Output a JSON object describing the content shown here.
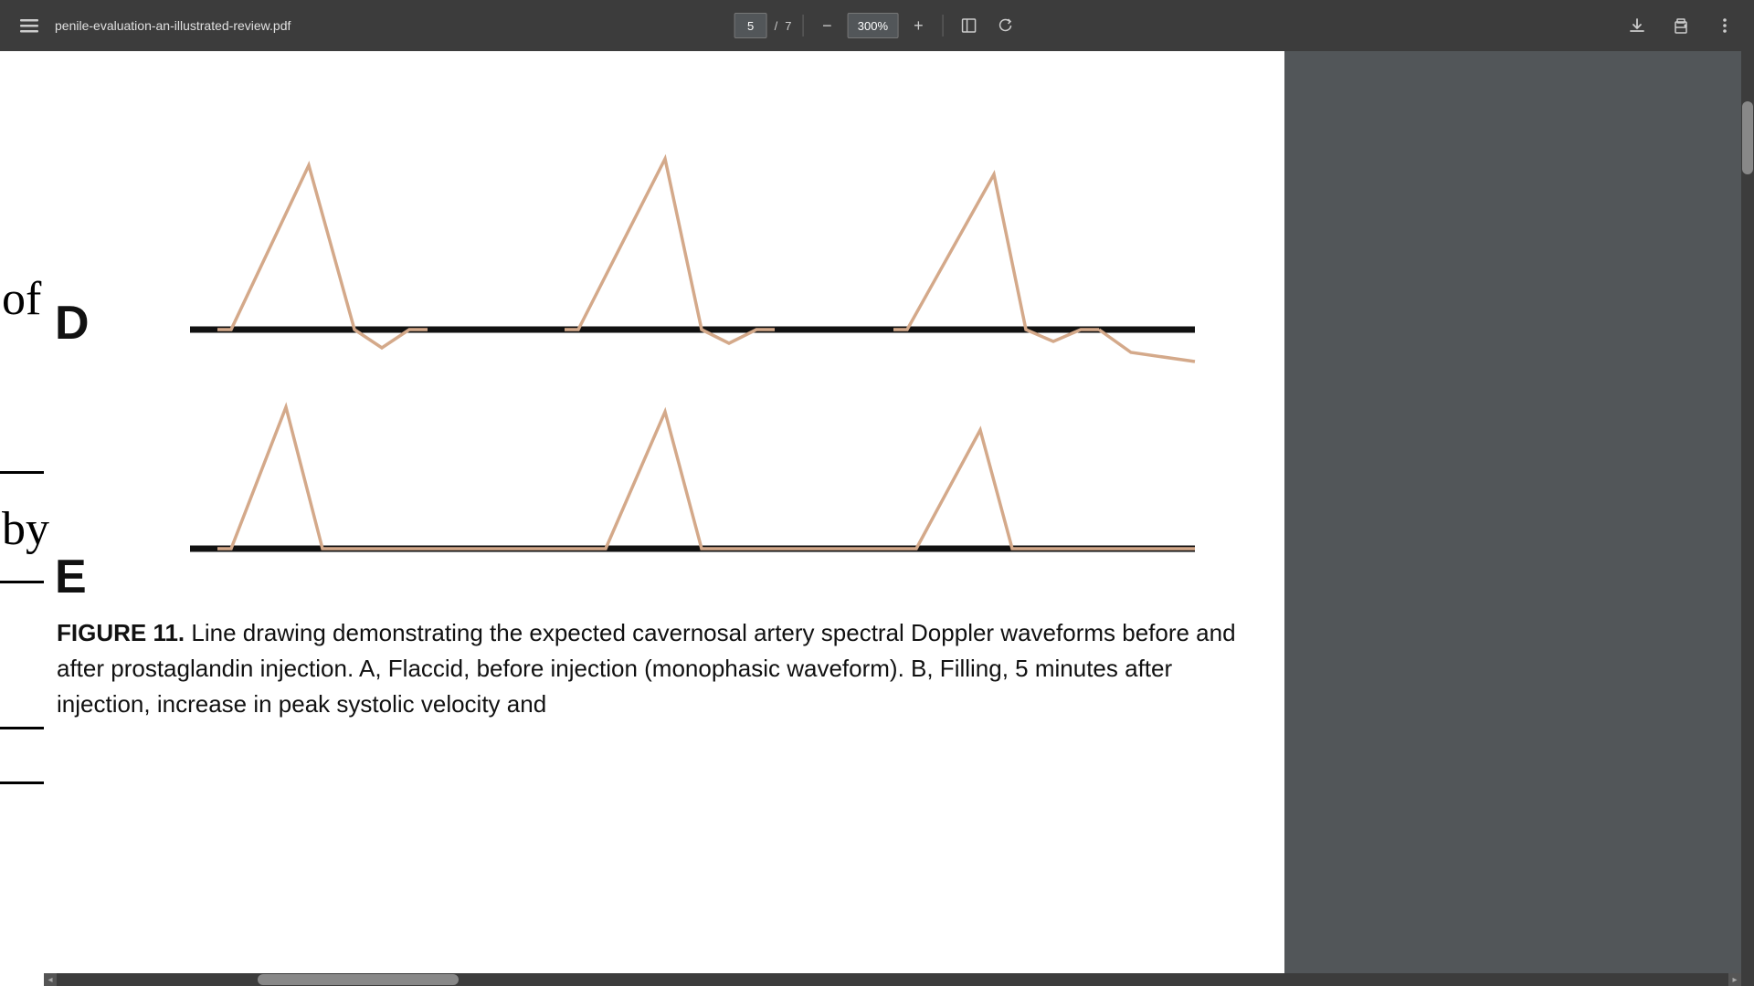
{
  "toolbar": {
    "menu_label": "☰",
    "title": "penile-evaluation-an-illustrated-review.pdf",
    "page_current": "5",
    "page_separator": "/",
    "page_total": "7",
    "zoom_minus": "−",
    "zoom_level": "300%",
    "zoom_plus": "+",
    "download_icon": "⬇",
    "print_icon": "🖨",
    "more_icon": "⋮",
    "rotate_icon": "↺",
    "fit_icon": "⊡"
  },
  "left_text": {
    "of": "of",
    "by": "by"
  },
  "chart": {
    "label_d": "D",
    "label_e": "E",
    "wave_color": "#d4a98a",
    "baseline_color": "#111"
  },
  "figure": {
    "label": "FIGURE 11.",
    "text": " Line drawing demonstrating the expected cavernosal artery spectral Doppler waveforms before and after prostaglandin injection. A, Flaccid, before injection (monophasic waveform). B, Filling, 5 minutes after injection, increase in peak systolic velocity and"
  },
  "scrollbar": {
    "bottom_arrow_left": "◂",
    "bottom_arrow_right": "▸"
  }
}
